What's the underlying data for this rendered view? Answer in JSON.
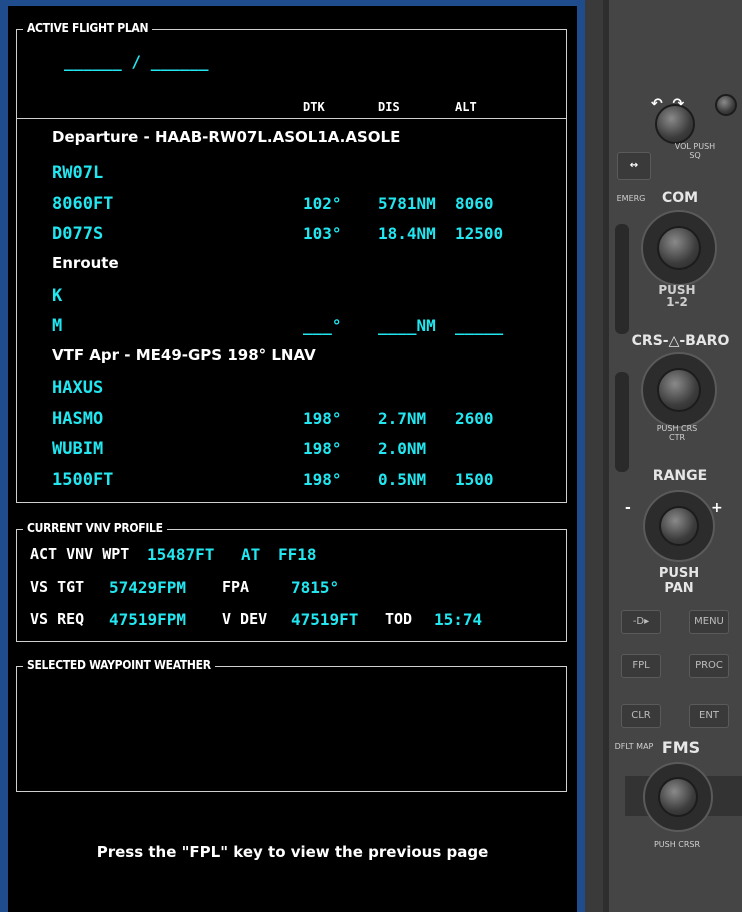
{
  "active_flight_plan": {
    "title": "ACTIVE FLIGHT PLAN",
    "route_placeholder": "______ / ______",
    "columns": {
      "dtk": "DTK",
      "dis": "DIS",
      "alt": "ALT"
    },
    "sections": [
      {
        "header": "Departure - HAAB-RW07L.ASOL1A.ASOLE"
      },
      {
        "header": "Enroute"
      },
      {
        "header": "VTF Apr - ME49-GPS 198° LNAV"
      }
    ],
    "rows": [
      {
        "id": "RW07L",
        "dtk": "",
        "dis": "",
        "alt": ""
      },
      {
        "id": "8060FT",
        "dtk": "102°",
        "dis": "5781NM",
        "alt": "8060"
      },
      {
        "id": "D077S",
        "dtk": "103°",
        "dis": "18.4NM",
        "alt": "12500"
      },
      {
        "id": "K",
        "dtk": "",
        "dis": "",
        "alt": ""
      },
      {
        "id": "M",
        "dtk": "___°",
        "dis": "____NM",
        "alt": "_____"
      },
      {
        "id": "HAXUS",
        "dtk": "",
        "dis": "",
        "alt": ""
      },
      {
        "id": "HASMO",
        "dtk": "198°",
        "dis": "2.7NM",
        "alt": "2600"
      },
      {
        "id": "WUBIM",
        "dtk": "198°",
        "dis": "2.0NM",
        "alt": ""
      },
      {
        "id": "1500FT",
        "dtk": "198°",
        "dis": "0.5NM",
        "alt": "1500"
      }
    ]
  },
  "vnv_profile": {
    "title": "CURRENT VNV PROFILE",
    "act_vnv_wpt_label": "ACT VNV WPT",
    "act_vnv_wpt_alt": "15487FT",
    "at_label": "AT",
    "act_vnv_wpt_id": "FF18",
    "vs_tgt_label": "VS TGT",
    "vs_tgt_value": "57429FPM",
    "fpa_label": "FPA",
    "fpa_value": "7815°",
    "vs_req_label": "VS REQ",
    "vs_req_value": "47519FPM",
    "vdev_label": "V DEV",
    "vdev_value": "47519FT",
    "tod_label": "TOD",
    "tod_value": "15:74"
  },
  "weather": {
    "title": "SELECTED WAYPOINT WEATHER"
  },
  "footer_note": "Press the \"FPL\" key to view the previous page",
  "bezel": {
    "vol_label": "VOL PUSH SQ",
    "emerg_label": "EMERG",
    "com_label": "COM",
    "push12_label": "PUSH 1-2",
    "crs_baro_label": "CRS-△-BARO",
    "push_crs_ctr_label": "PUSH CRS CTR",
    "range_label": "RANGE",
    "push_pan_label": "PUSH PAN",
    "direct_key": "-D▸",
    "menu_key": "MENU",
    "fpl_key": "FPL",
    "proc_key": "PROC",
    "clr_key": "CLR",
    "ent_key": "ENT",
    "dflt_map_label": "DFLT MAP",
    "fms_label": "FMS",
    "push_crsr_label": "PUSH CRSR"
  },
  "colors": {
    "cyan": "#22e6f0",
    "white": "#ffffff",
    "frame": "#1f4c8c"
  }
}
